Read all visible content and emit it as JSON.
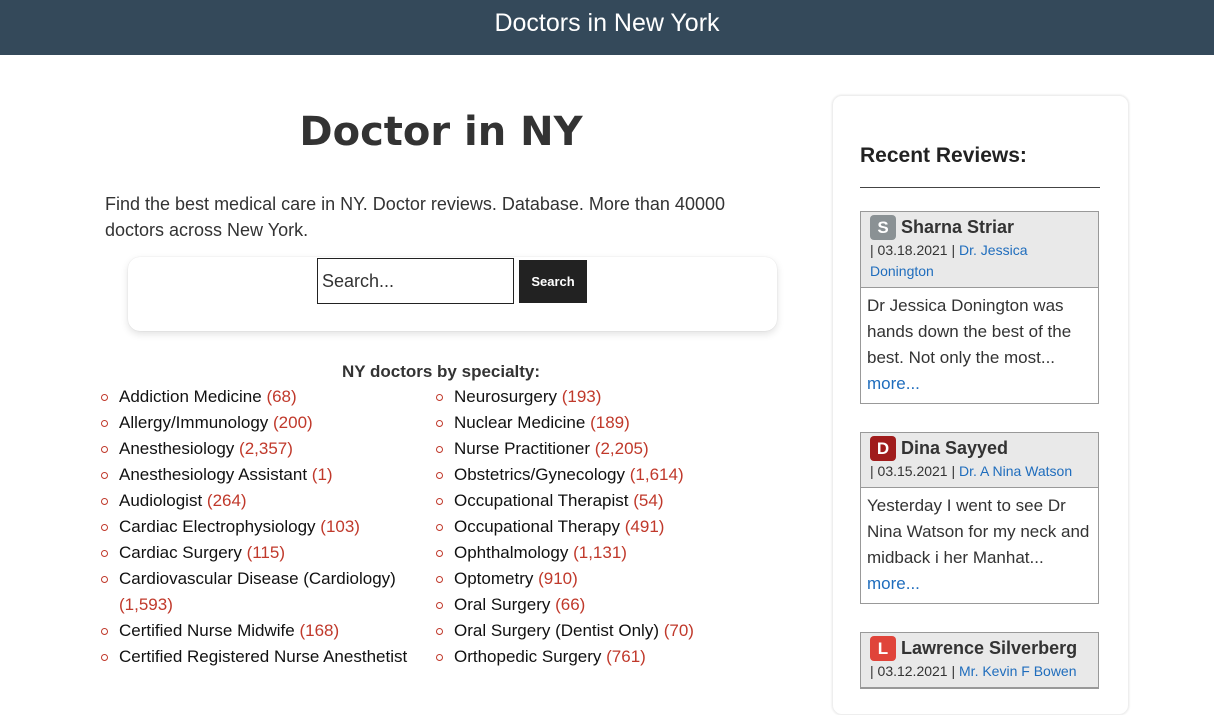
{
  "header": {
    "title": "Doctors in New York"
  },
  "main": {
    "title": "Doctor in NY",
    "intro": "Find the best medical care in NY. Doctor reviews. Database. More than 40000 doctors across New York.",
    "search": {
      "placeholder": "Search...",
      "button_label": "Search"
    },
    "specialty_heading": "NY doctors by specialty:",
    "specialties_left": [
      {
        "name": "Addiction Medicine",
        "count": "(68)"
      },
      {
        "name": "Allergy/Immunology",
        "count": "(200)"
      },
      {
        "name": "Anesthesiology",
        "count": "(2,357)"
      },
      {
        "name": "Anesthesiology Assistant",
        "count": "(1)"
      },
      {
        "name": "Audiologist",
        "count": "(264)"
      },
      {
        "name": "Cardiac Electrophysiology",
        "count": "(103)"
      },
      {
        "name": "Cardiac Surgery",
        "count": "(115)"
      },
      {
        "name": "Cardiovascular Disease (Cardiology)",
        "count": "(1,593)"
      },
      {
        "name": "Certified Nurse Midwife",
        "count": "(168)"
      },
      {
        "name": "Certified Registered Nurse Anesthetist",
        "count": ""
      }
    ],
    "specialties_right": [
      {
        "name": "Neurosurgery",
        "count": "(193)"
      },
      {
        "name": "Nuclear Medicine",
        "count": "(189)"
      },
      {
        "name": "Nurse Practitioner",
        "count": "(2,205)"
      },
      {
        "name": "Obstetrics/Gynecology",
        "count": "(1,614)"
      },
      {
        "name": "Occupational Therapist",
        "count": "(54)"
      },
      {
        "name": "Occupational Therapy",
        "count": "(491)"
      },
      {
        "name": "Ophthalmology",
        "count": "(1,131)"
      },
      {
        "name": "Optometry",
        "count": "(910)"
      },
      {
        "name": "Oral Surgery",
        "count": "(66)"
      },
      {
        "name": "Oral Surgery (Dentist Only)",
        "count": "(70)"
      },
      {
        "name": "Orthopedic Surgery",
        "count": "(761)"
      }
    ]
  },
  "sidebar": {
    "title": "Recent Reviews:",
    "reviews": [
      {
        "initial": "S",
        "avatar_color": "#8a9194",
        "name": "Sharna Striar",
        "date": "| 03.18.2021 |",
        "doctor": "Dr. Jessica Donington",
        "excerpt": "Dr Jessica Donington was hands down the best of the best. Not only the most...",
        "more": "more..."
      },
      {
        "initial": "D",
        "avatar_color": "#a01c1c",
        "name": "Dina Sayyed",
        "date": "| 03.15.2021 |",
        "doctor": "Dr. A Nina Watson",
        "excerpt": "Yesterday I went to see Dr Nina Watson for my neck and midback i her Manhat...",
        "more": "more..."
      },
      {
        "initial": "L",
        "avatar_color": "#e0443a",
        "name": "Lawrence Silverberg",
        "date": "| 03.12.2021 |",
        "doctor": "Mr. Kevin F Bowen",
        "excerpt": "",
        "more": ""
      }
    ]
  }
}
